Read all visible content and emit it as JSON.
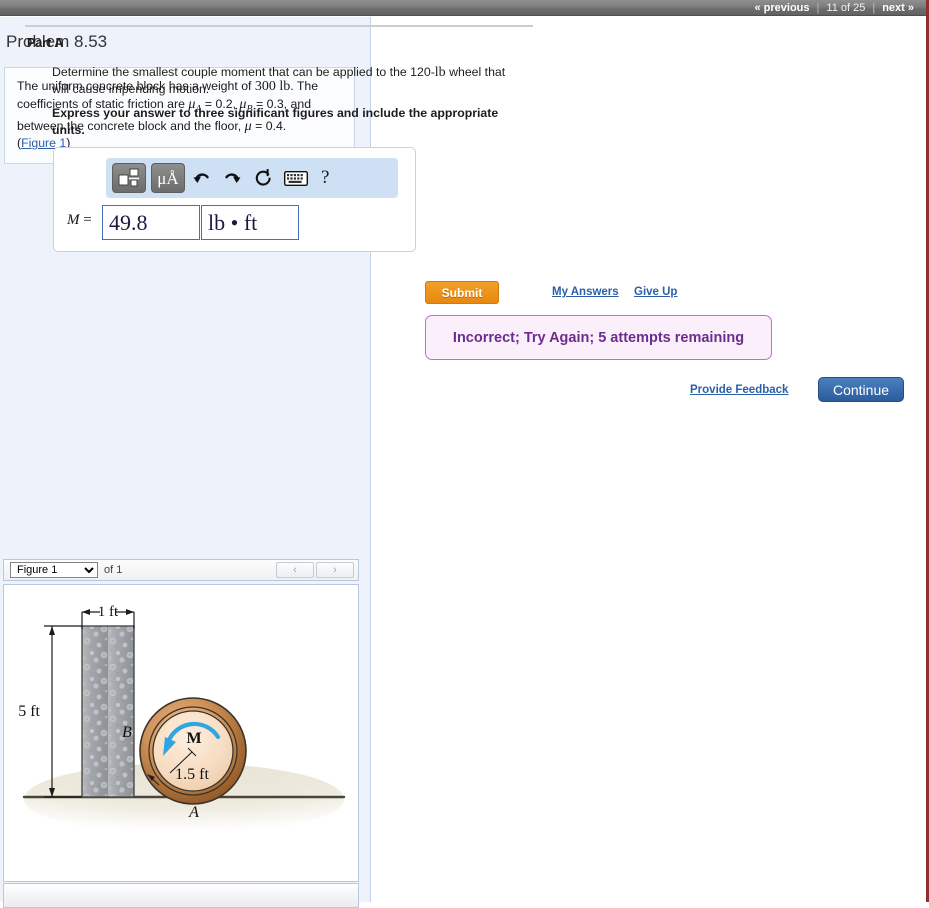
{
  "topbar": {
    "previous": "« previous",
    "counter": "11 of 25",
    "next": "next »",
    "separator": "|"
  },
  "problem": {
    "title": "Problem 8.53",
    "statement_line1": "The uniform concrete block has a weight of",
    "weight": "300 lb",
    "statement_line2": ". The coefficients of static friction are",
    "mu_a": "μ",
    "mu_a_sub": "A",
    "mu_a_value": "= 0.2,",
    "mu_b": "μ",
    "mu_b_sub": "B",
    "mu_b_value": "= 0.3,",
    "statement_line3": "and between the concrete block and the floor,",
    "mu": "μ",
    "mu_value": "= 0.4.",
    "figure_link": "Figure 1",
    "paren_open": "(",
    "paren_close": ")"
  },
  "figure_nav": {
    "selected": "Figure 1",
    "options": [
      "Figure 1"
    ],
    "of_label": "of 1",
    "prev_arrow": "‹",
    "next_arrow": "›"
  },
  "figure": {
    "dim_width": "1 ft",
    "dim_height": "5 ft",
    "dim_radius": "1.5 ft",
    "label_block": "B",
    "label_ground": "A",
    "label_moment": "M",
    "colors": {
      "block_fill": "#a0a4a8",
      "wheel_rim_outer": "#b0763f",
      "wheel_rim_mid": "#d9a06a",
      "wheel_inner": "#f5dcc2",
      "moment_arrow": "#2fa6e0",
      "ground_line": "#3a3a3a",
      "ground_shade": "#e9e6d8"
    }
  },
  "part_a": {
    "heading": "Part A",
    "question_pre": "Determine the smallest couple moment that can be applied to the 120-",
    "question_unit": "lb",
    "question_post": " wheel that will cause impending motion.",
    "instruction": "Express your answer to three significant figures and include the appropriate units."
  },
  "answer": {
    "variable_label": "M",
    "equals": "=",
    "value": "49.8",
    "units": "lb • ft",
    "value_placeholder": "",
    "units_placeholder": "",
    "toolbar": {
      "template_icon": "template-icon",
      "units_icon": "μÅ",
      "undo_icon": "undo-icon",
      "redo_icon": "redo-icon",
      "reset_icon": "reset-icon",
      "keyboard_icon": "keyboard-icon",
      "help_icon": "?"
    }
  },
  "actions": {
    "submit": "Submit",
    "my_answers": "My Answers",
    "give_up": "Give Up",
    "provide_feedback": "Provide Feedback",
    "continue": "Continue"
  },
  "status": {
    "message": "Incorrect; Try Again; 5 attempts remaining",
    "color": "#6c2d8e",
    "background": "#fbeffb"
  }
}
